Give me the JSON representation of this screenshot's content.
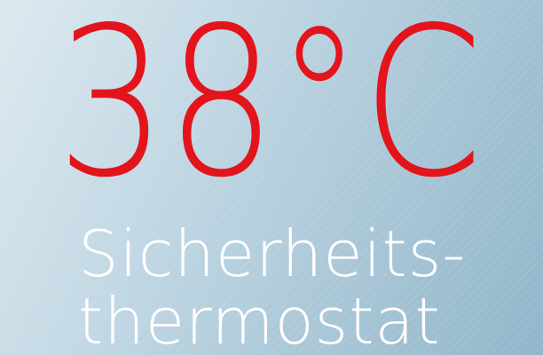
{
  "temperature": {
    "text": "38°C",
    "color": "#e3141b"
  },
  "label": {
    "line1": "Sicherheits-",
    "line2": "thermostat",
    "color": "#ffffff"
  },
  "background": {
    "color_light": "#dde9ef",
    "color_dark": "#91b6ca"
  }
}
